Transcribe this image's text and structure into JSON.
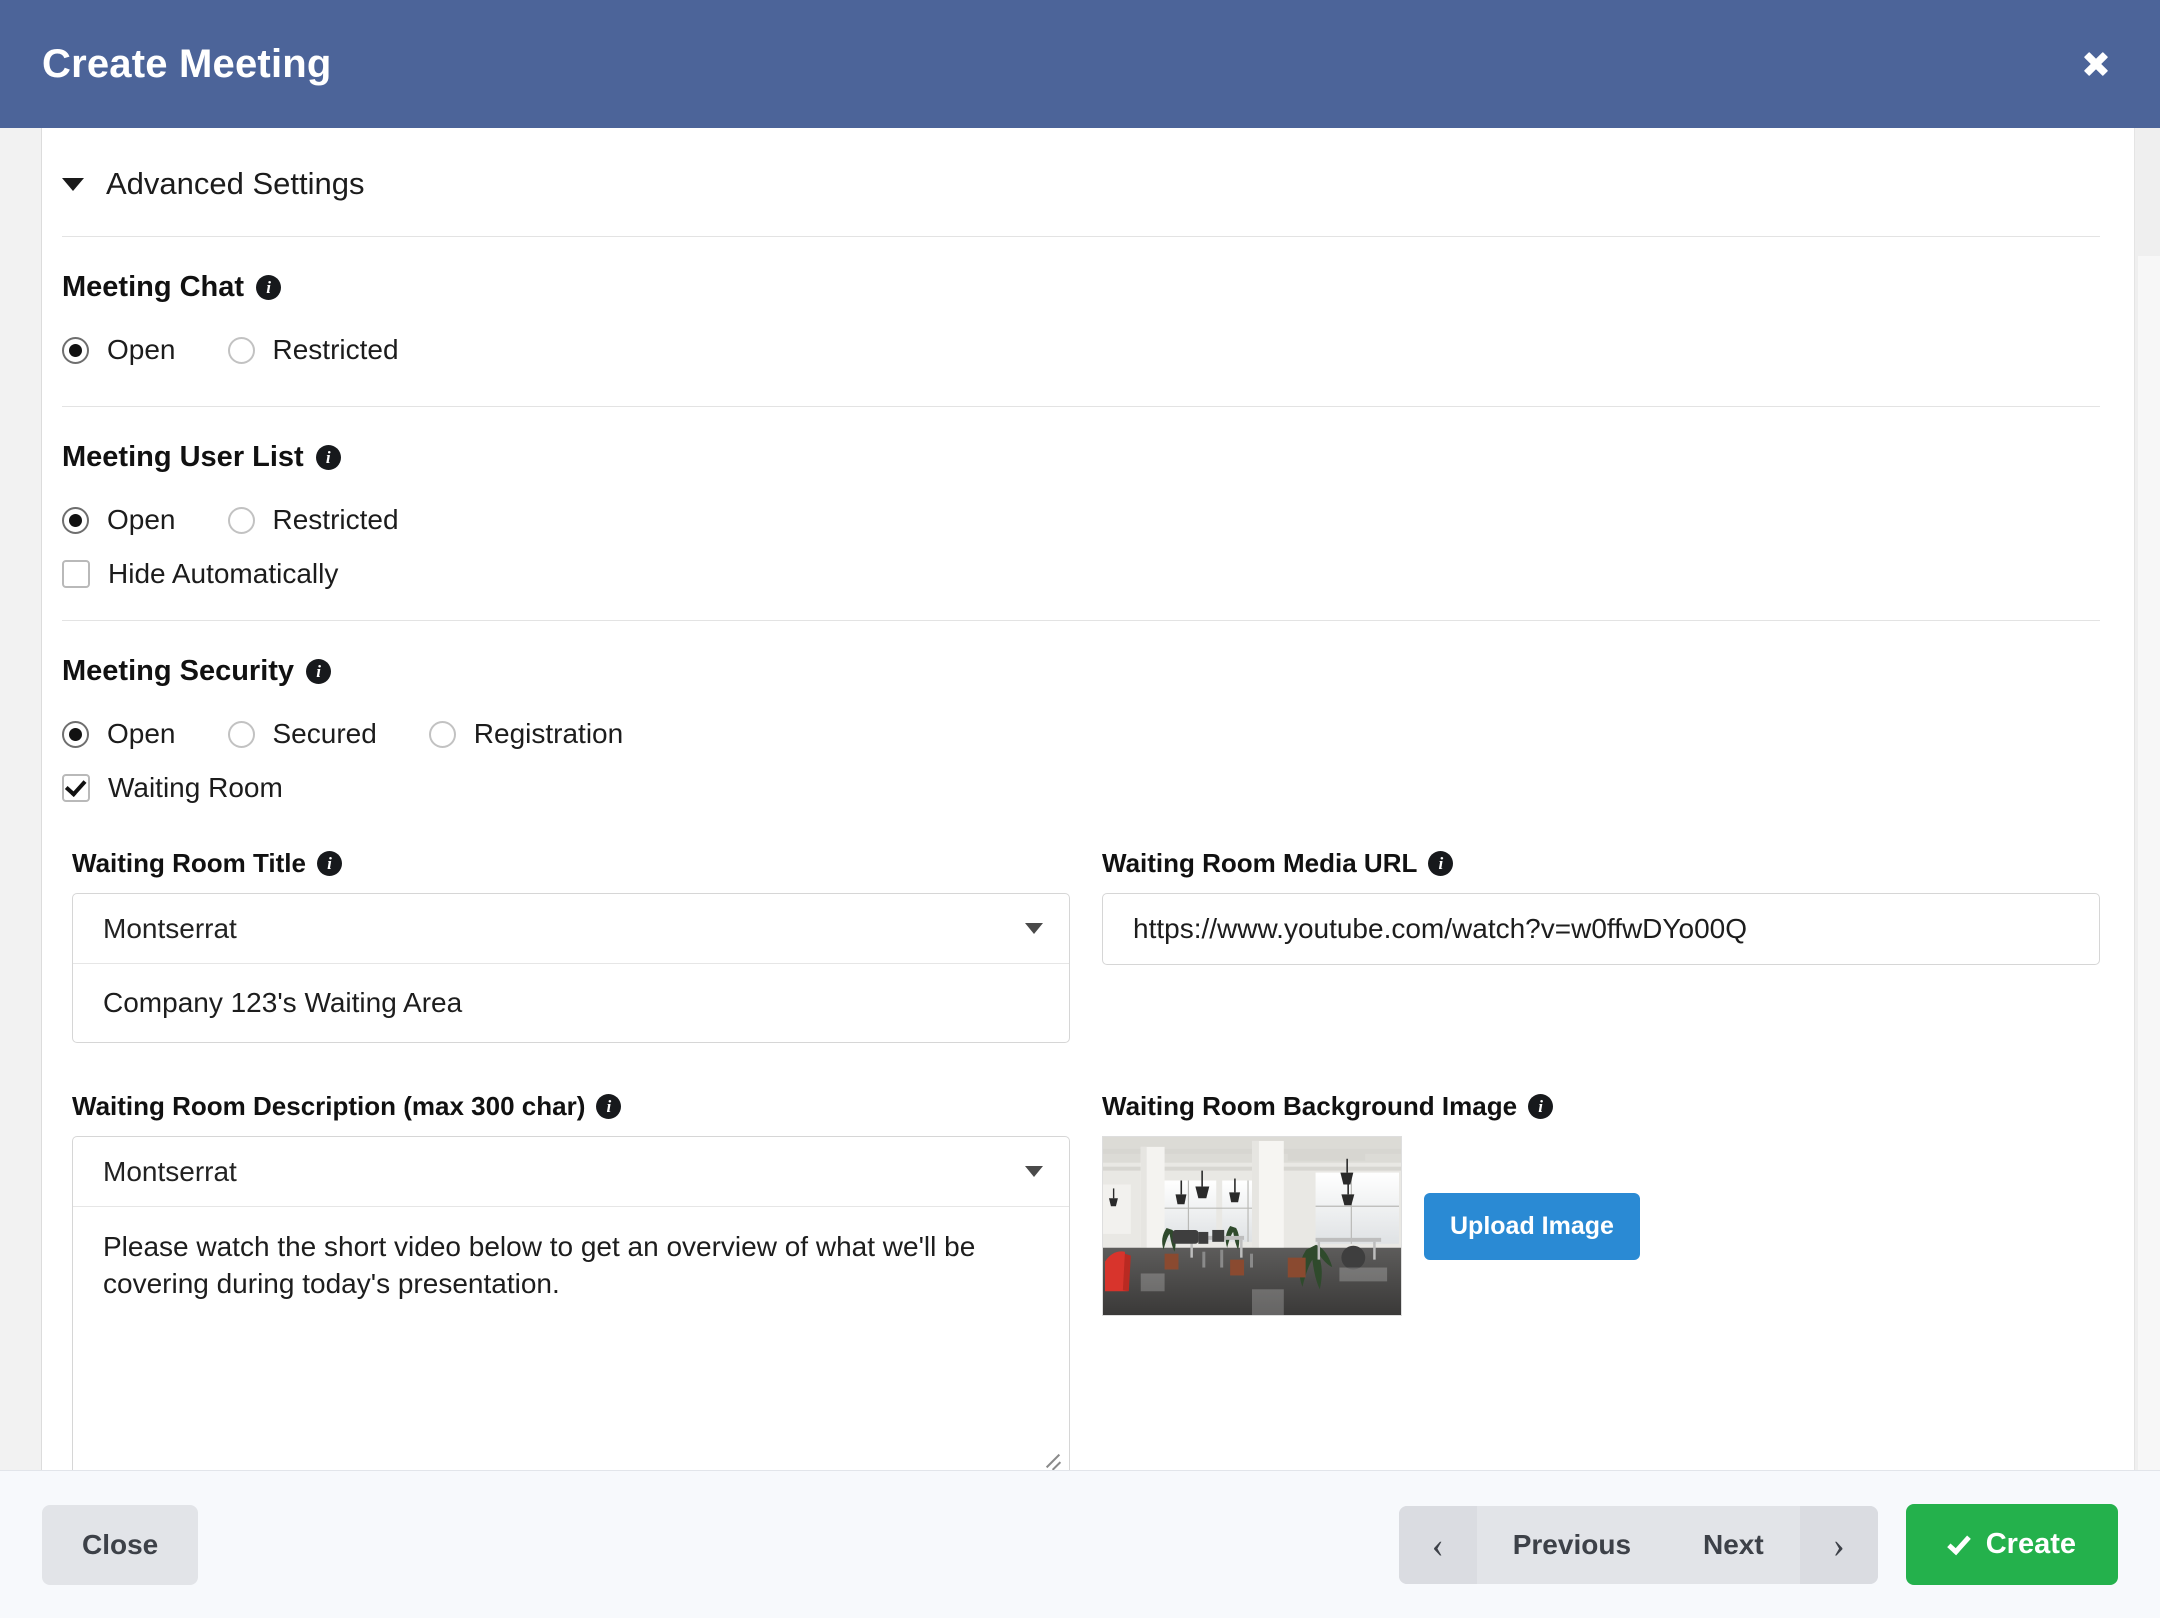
{
  "header": {
    "title": "Create Meeting",
    "close_icon": "close-icon"
  },
  "advanced": {
    "label": "Advanced Settings",
    "caret_icon": "caret-down-icon"
  },
  "sections": {
    "meeting_chat": {
      "title": "Meeting Chat",
      "info_icon": "info-icon",
      "options": [
        "Open",
        "Restricted"
      ],
      "selected": "Open"
    },
    "meeting_user_list": {
      "title": "Meeting User List",
      "info_icon": "info-icon",
      "options": [
        "Open",
        "Restricted"
      ],
      "selected": "Open",
      "hide_automatically_label": "Hide Automatically",
      "hide_automatically_checked": false
    },
    "meeting_security": {
      "title": "Meeting Security",
      "info_icon": "info-icon",
      "options": [
        "Open",
        "Secured",
        "Registration"
      ],
      "selected": "Open",
      "waiting_room_label": "Waiting Room",
      "waiting_room_checked": true
    }
  },
  "waiting_room": {
    "title_field": {
      "label": "Waiting Room Title",
      "font_value": "Montserrat",
      "text_value": "Company 123's Waiting Area"
    },
    "media_url_field": {
      "label": "Waiting Room Media URL",
      "value": "https://www.youtube.com/watch?v=w0ffwDYo00Q"
    },
    "description_field": {
      "label": "Waiting Room Description (max 300 char)",
      "font_value": "Montserrat",
      "text_value": "Please watch the short video below to get an overview of what we'll be covering during today's presentation."
    },
    "background_image_field": {
      "label": "Waiting Room Background Image",
      "upload_button_label": "Upload Image",
      "thumbnail_alt": "office-interior-thumbnail"
    }
  },
  "footer": {
    "close_label": "Close",
    "previous_label": "Previous",
    "next_label": "Next",
    "prev_arrow": "‹",
    "next_arrow": "›",
    "create_label": "Create"
  },
  "colors": {
    "header_blue": "#4c6499",
    "create_green": "#24b14c",
    "upload_blue": "#2a8ad4",
    "footer_bg": "#f7f9fc"
  }
}
